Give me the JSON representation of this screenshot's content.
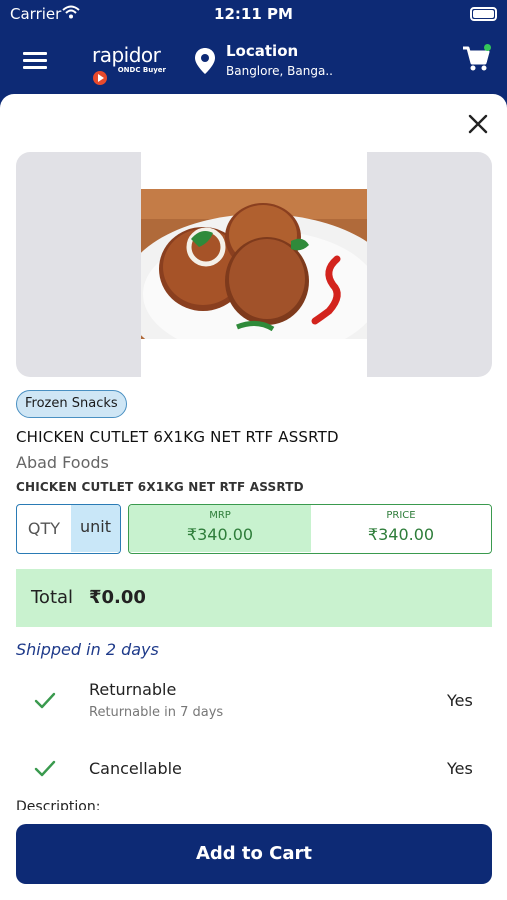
{
  "status_bar": {
    "carrier": "Carrier",
    "time": "12:11 PM"
  },
  "header": {
    "logo_text": "rapidor",
    "logo_subtext": "ONDC Buyer",
    "location_title": "Location",
    "location_value": "Banglore, Banga..",
    "cart_badge_color": "#34c759"
  },
  "product": {
    "category": "Frozen Snacks",
    "title": "CHICKEN CUTLET 6X1KG NET RTF ASSRTD",
    "brand": "Abad Foods",
    "subtitle": "CHICKEN CUTLET 6X1KG NET RTF ASSRTD"
  },
  "quantity": {
    "label": "QTY",
    "unit": "unit"
  },
  "pricing": {
    "mrp_label": "MRP",
    "mrp_value": "₹340.00",
    "price_label": "PRICE",
    "price_value": "₹340.00"
  },
  "total": {
    "label": "Total",
    "value": "₹0.00"
  },
  "shipping": "Shipped in 2 days",
  "policies": [
    {
      "title": "Returnable",
      "subtitle": "Returnable in 7 days",
      "value": "Yes"
    },
    {
      "title": "Cancellable",
      "subtitle": "",
      "value": "Yes"
    }
  ],
  "description_label": "Description:",
  "actions": {
    "add_to_cart": "Add to Cart"
  },
  "colors": {
    "brand_navy": "#0d2a75",
    "total_bg": "#c9f2cf",
    "price_green": "#2e7d3a",
    "check_green": "#3a9a4e"
  }
}
